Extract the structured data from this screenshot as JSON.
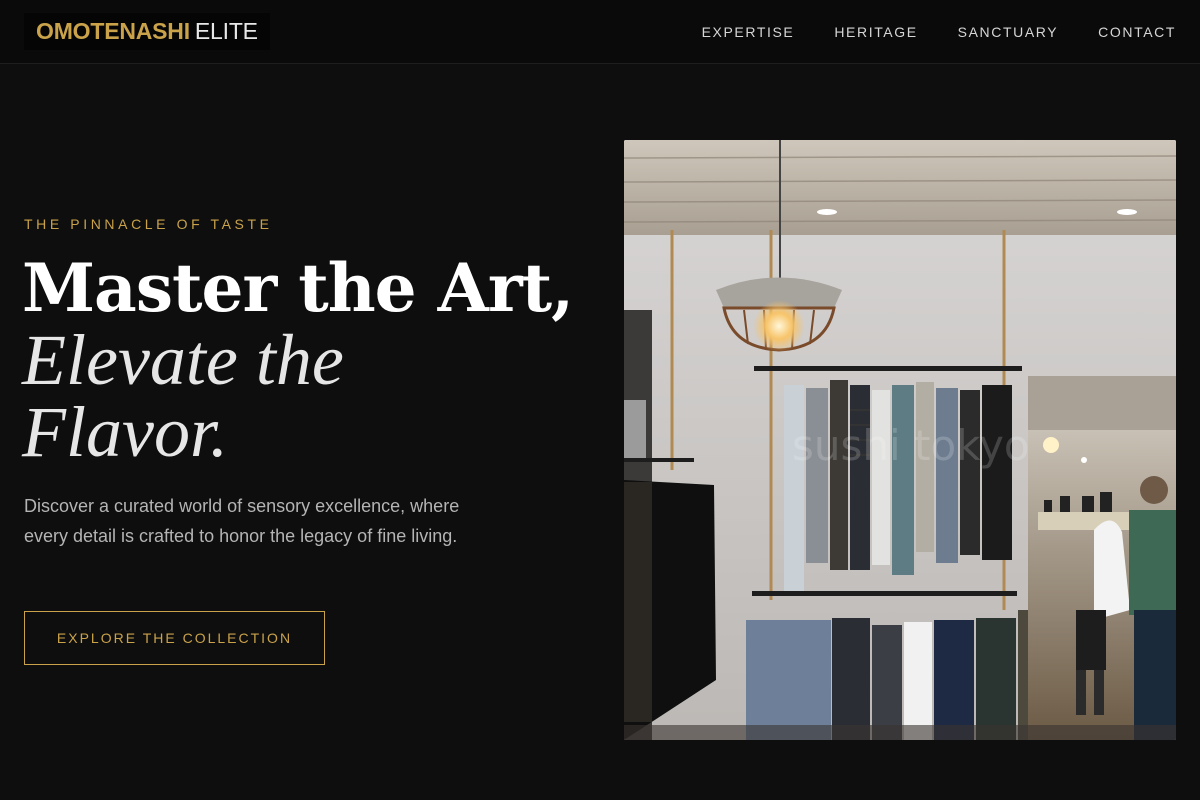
{
  "nav": {
    "brand_primary": "OMOTENASHI",
    "brand_secondary": "ELITE",
    "links": [
      "EXPERTISE",
      "HERITAGE",
      "SANCTUARY",
      "CONTACT"
    ]
  },
  "hero": {
    "eyebrow": "THE PINNACLE OF TASTE",
    "headline_line1": "Master the Art,",
    "headline_line2": "Elevate the",
    "headline_line3": "Flavor.",
    "body": "Discover a curated world of sensory excellence, where every detail is crafted to honor the legacy of fine living.",
    "cta_label": "EXPLORE THE COLLECTION",
    "image_watermark": "sushi tokyo"
  },
  "colors": {
    "accent_gold": "#c9a24a",
    "background": "#0e0e0e",
    "nav_background": "#0a0a0a"
  }
}
